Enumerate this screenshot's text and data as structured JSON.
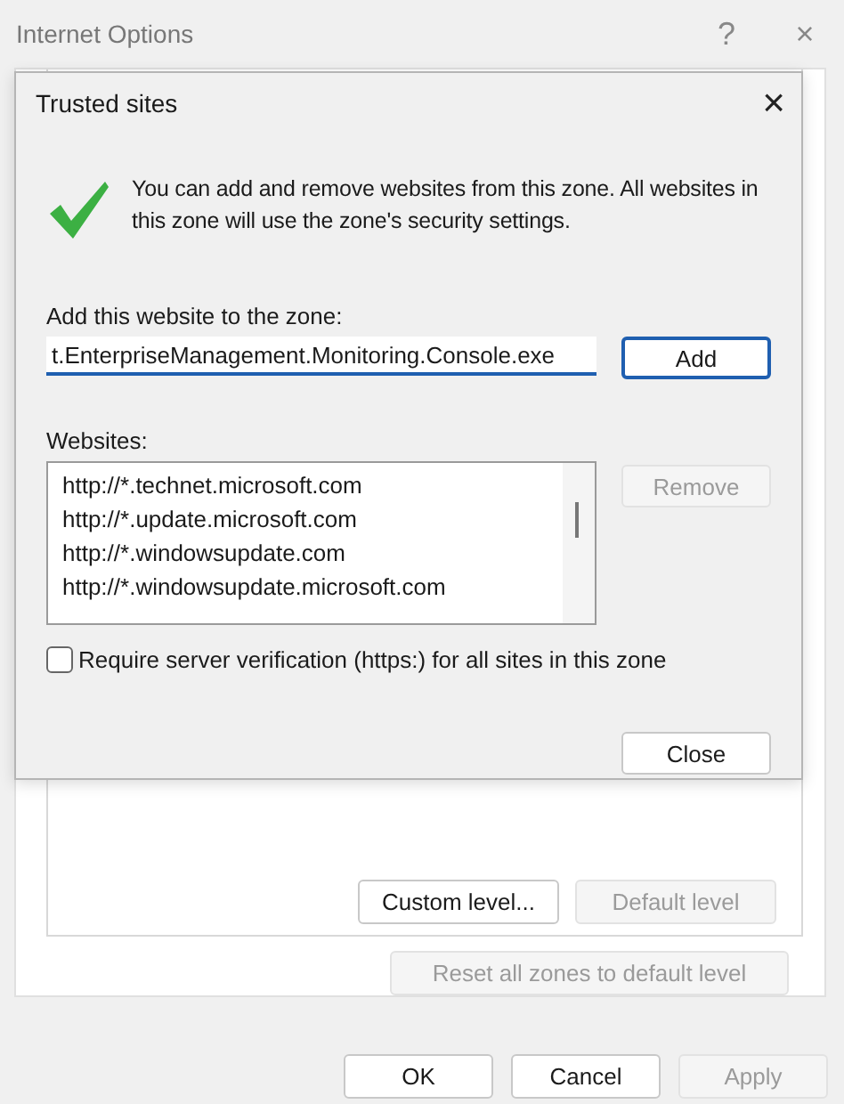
{
  "window": {
    "title": "Internet Options",
    "help": "?",
    "close": "×"
  },
  "dialog": {
    "title": "Trusted sites",
    "close": "×",
    "message": "You can add and remove websites from this zone. All websites in this zone will use the zone's security settings.",
    "add_label": "Add this website to the zone:",
    "add_value": "t.EnterpriseManagement.Monitoring.Console.exe",
    "add_button": {
      "label": "Add",
      "disabled": false,
      "default": true
    },
    "websites_label": "Websites:",
    "websites": [
      "http://*.technet.microsoft.com",
      "http://*.update.microsoft.com",
      "http://*.windowsupdate.com",
      "http://*.windowsupdate.microsoft.com"
    ],
    "remove_button": {
      "label": "Remove",
      "disabled": true,
      "default": false
    },
    "require_https": {
      "label": "Require server verification (https:) for all sites in this zone",
      "checked": false
    },
    "close_button": {
      "label": "Close",
      "disabled": false,
      "default": false
    }
  },
  "zone_buttons": [
    {
      "label": "Custom level...",
      "disabled": false
    },
    {
      "label": "Default level",
      "disabled": true
    }
  ],
  "reset_button": {
    "label": "Reset all zones to default level",
    "disabled": true
  },
  "buttons": [
    {
      "label": "OK",
      "disabled": false
    },
    {
      "label": "Cancel",
      "disabled": false
    },
    {
      "label": "Apply",
      "disabled": true
    }
  ]
}
